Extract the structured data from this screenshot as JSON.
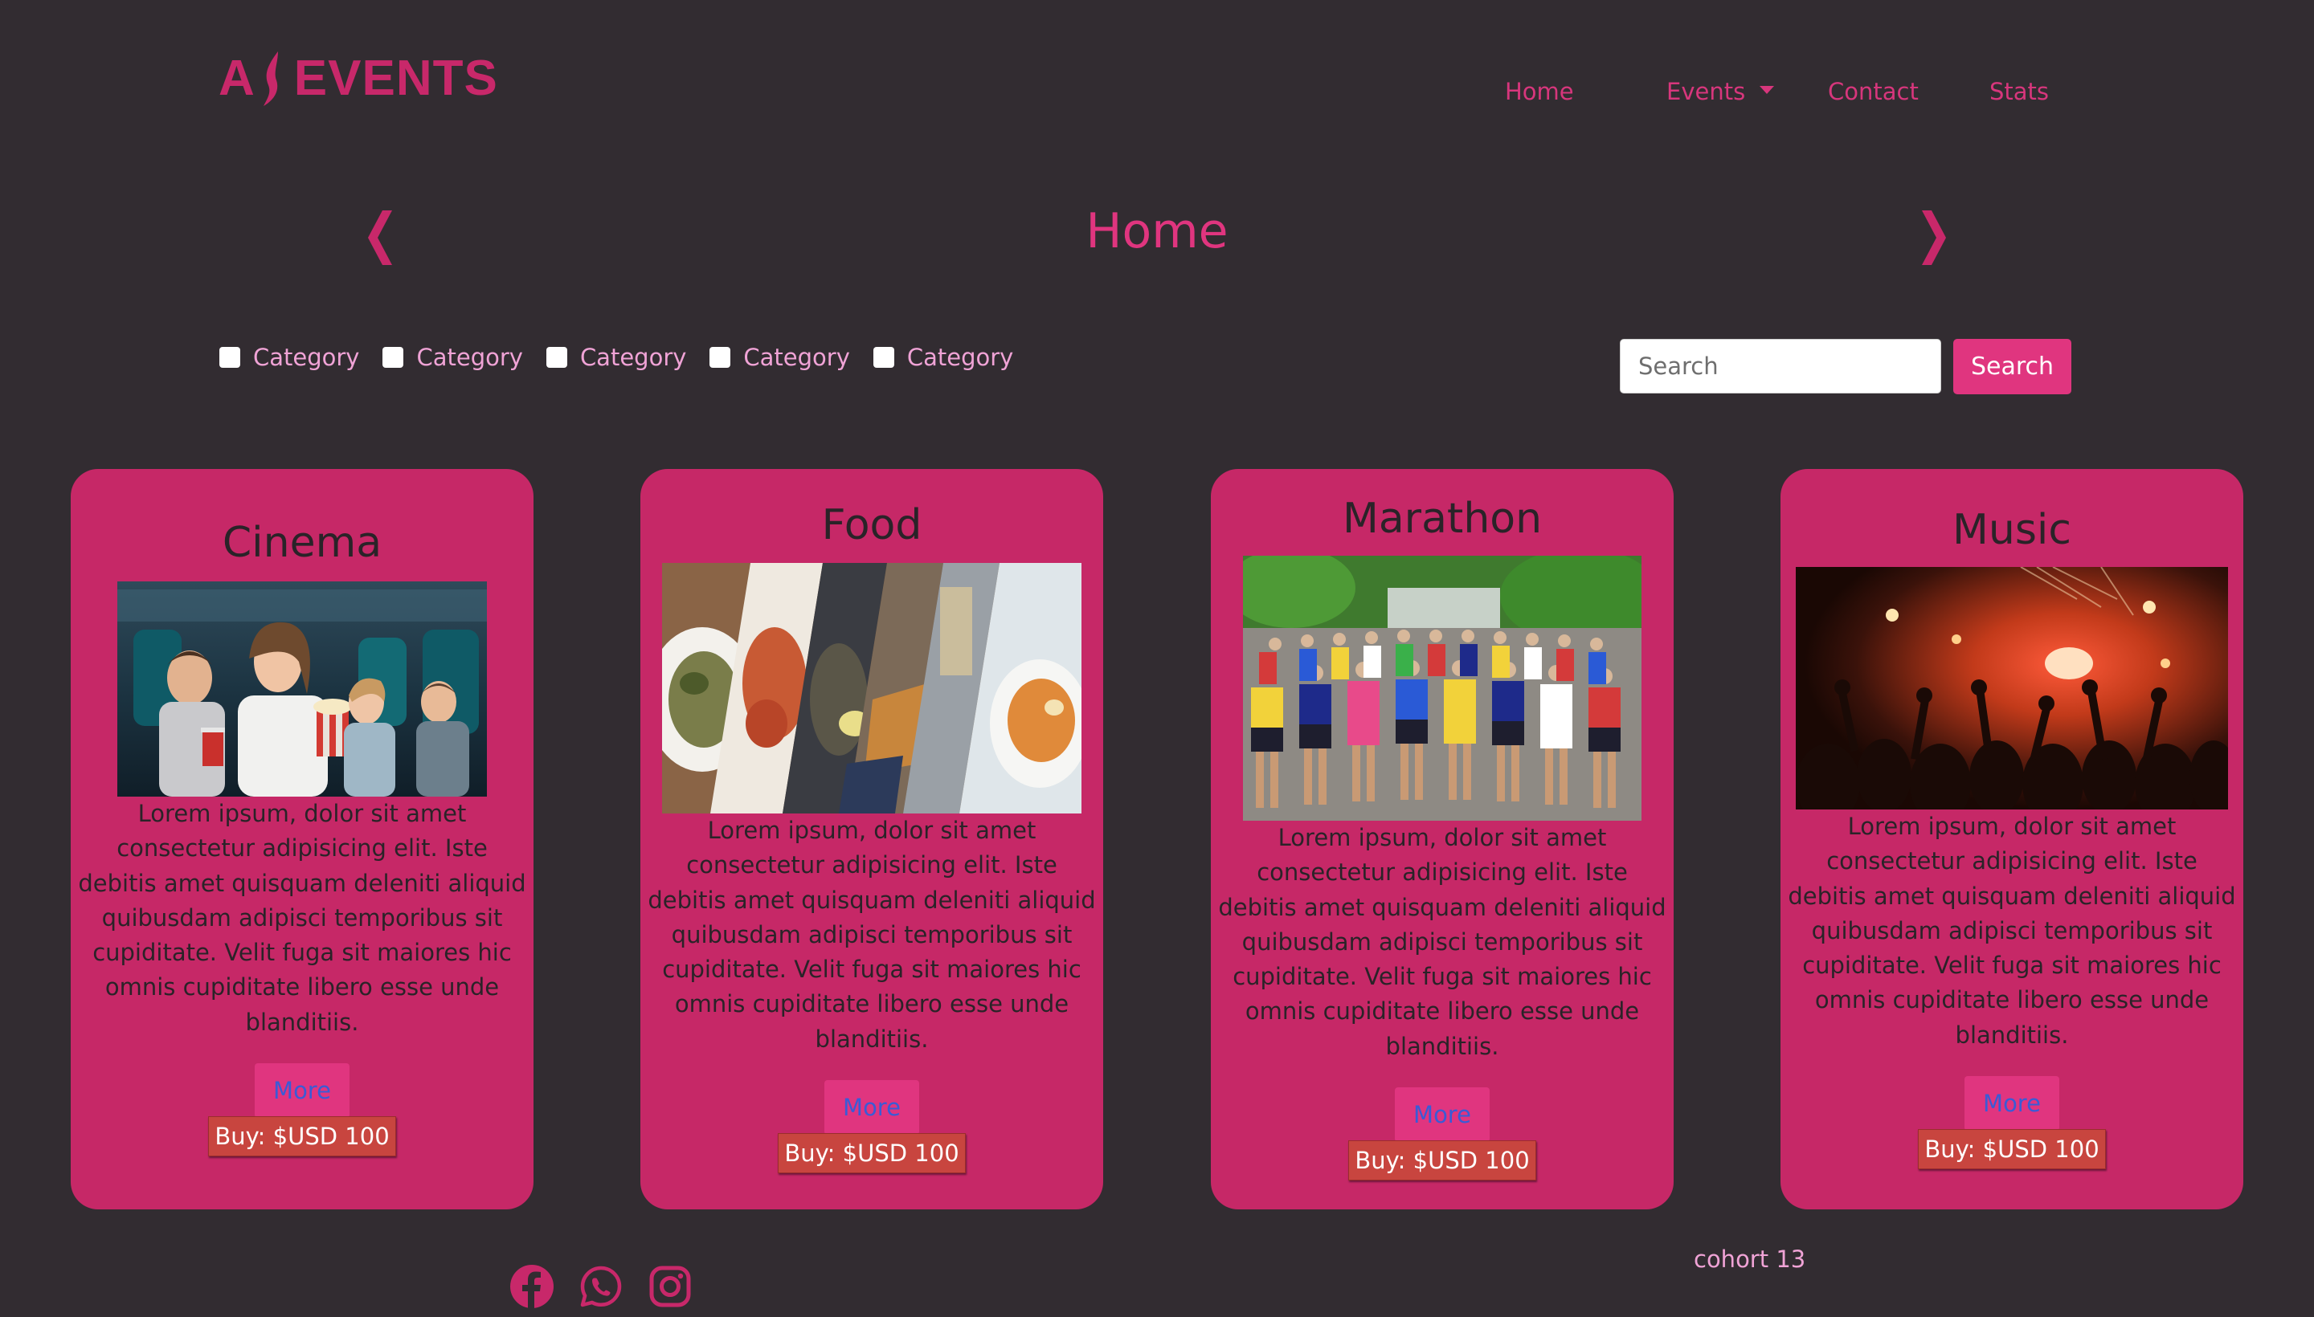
{
  "brand": {
    "logo_text_left": "A",
    "logo_text_right": "EVENTS",
    "color": "#c8286a"
  },
  "nav": {
    "home": "Home",
    "events": "Events",
    "contact": "Contact",
    "stats": "Stats"
  },
  "page": {
    "title": "Home",
    "prev_icon": "chevron-left-icon",
    "next_icon": "chevron-right-icon"
  },
  "filters": {
    "categories": [
      "Category",
      "Category",
      "Category",
      "Category",
      "Category"
    ]
  },
  "search": {
    "placeholder": "Search",
    "button_label": "Search"
  },
  "cards": [
    {
      "title": "Cinema",
      "image": "cinema-audience-photo",
      "description": "Lorem ipsum, dolor sit amet consectetur adipisicing elit. Iste debitis amet quisquam deleniti aliquid quibusdam adipisci temporibus sit cupiditate. Velit fuga sit maiores hic omnis cupiditate libero esse unde blanditiis.",
      "more_label": "More",
      "buy_label": "Buy: $USD 100"
    },
    {
      "title": "Food",
      "image": "food-collage-photo",
      "description": "Lorem ipsum, dolor sit amet consectetur adipisicing elit. Iste debitis amet quisquam deleniti aliquid quibusdam adipisci temporibus sit cupiditate. Velit fuga sit maiores hic omnis cupiditate libero esse unde blanditiis.",
      "more_label": "More",
      "buy_label": "Buy: $USD 100"
    },
    {
      "title": "Marathon",
      "image": "marathon-runners-photo",
      "description": "Lorem ipsum, dolor sit amet consectetur adipisicing elit. Iste debitis amet quisquam deleniti aliquid quibusdam adipisci temporibus sit cupiditate. Velit fuga sit maiores hic omnis cupiditate libero esse unde blanditiis.",
      "more_label": "More",
      "buy_label": "Buy: $USD 100"
    },
    {
      "title": "Music",
      "image": "concert-crowd-photo",
      "description": "Lorem ipsum, dolor sit amet consectetur adipisicing elit. Iste debitis amet quisquam deleniti aliquid quibusdam adipisci temporibus sit cupiditate. Velit fuga sit maiores hic omnis cupiditate libero esse unde blanditiis.",
      "more_label": "More",
      "buy_label": "Buy: $USD 100"
    }
  ],
  "footer": {
    "socials": [
      "facebook-icon",
      "whatsapp-icon",
      "instagram-icon"
    ],
    "cohort": "cohort 13"
  },
  "colors": {
    "background": "#322c31",
    "accent": "#e0357f",
    "card": "#c62867",
    "buy": "#c8453f",
    "link_text": "#3a5bd6",
    "light_text": "#f0a3d6"
  }
}
